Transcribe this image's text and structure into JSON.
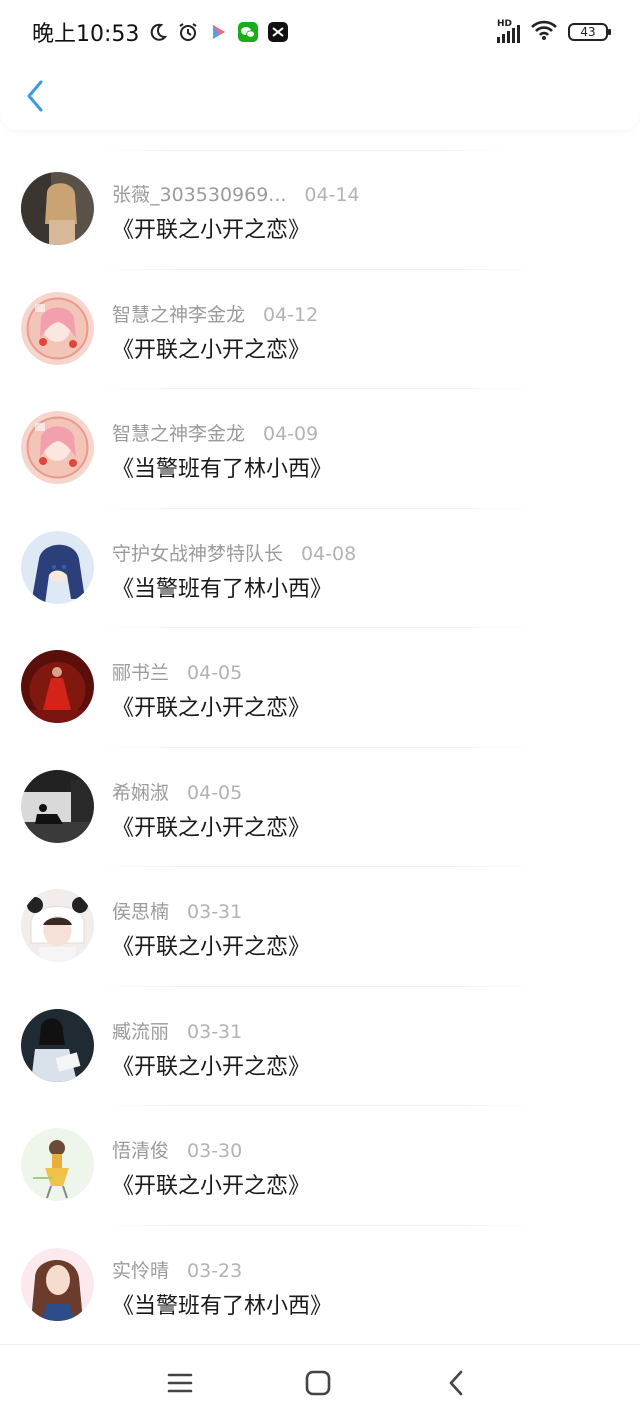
{
  "status_bar": {
    "time": "晚上10:53",
    "network": "HD",
    "battery": "43"
  },
  "header": {
    "back_icon": "chevron-left-icon"
  },
  "items": [
    {
      "name": "张薇_303530969...",
      "date": "04-14",
      "title": "《开联之小开之恋》",
      "avatar": "woman-portrait-avatar"
    },
    {
      "name": "智慧之神李金龙",
      "date": "04-12",
      "title": "《开联之小开之恋》",
      "avatar": "anime-girl-avatar"
    },
    {
      "name": "智慧之神李金龙",
      "date": "04-09",
      "title": "《当警班有了林小西》",
      "avatar": "anime-girl-avatar"
    },
    {
      "name": "守护女战神梦特队长",
      "date": "04-08",
      "title": "《当警班有了林小西》",
      "avatar": "anime-blue-hair-avatar"
    },
    {
      "name": "郦书兰",
      "date": "04-05",
      "title": "《开联之小开之恋》",
      "avatar": "red-dress-avatar"
    },
    {
      "name": "希娴淑",
      "date": "04-05",
      "title": "《开联之小开之恋》",
      "avatar": "bw-window-avatar"
    },
    {
      "name": "侯思楠",
      "date": "03-31",
      "title": "《开联之小开之恋》",
      "avatar": "panda-hat-avatar"
    },
    {
      "name": "臧流丽",
      "date": "03-31",
      "title": "《开联之小开之恋》",
      "avatar": "girl-book-avatar"
    },
    {
      "name": "悟清俊",
      "date": "03-30",
      "title": "《开联之小开之恋》",
      "avatar": "cartoon-girl-avatar"
    },
    {
      "name": "实怜晴",
      "date": "03-23",
      "title": "《当警班有了林小西》",
      "avatar": "long-hair-girl-avatar"
    }
  ],
  "nav": {
    "menu_icon": "menu-icon",
    "home_icon": "home-square-icon",
    "back_icon": "back-arrow-icon"
  }
}
